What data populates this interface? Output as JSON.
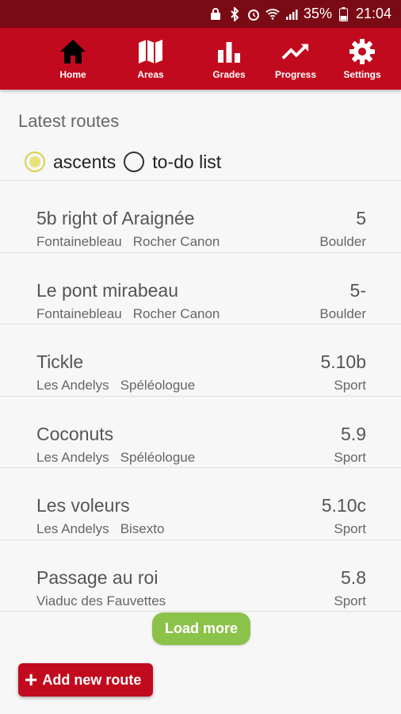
{
  "status_bar": {
    "battery": "35%",
    "time": "21:04",
    "icons": [
      "lock-icon",
      "bluetooth-icon",
      "alarm-icon",
      "wifi-icon",
      "signal-icon",
      "battery-icon"
    ]
  },
  "nav": {
    "items": [
      {
        "label": "Home",
        "icon": "home-icon"
      },
      {
        "label": "Areas",
        "icon": "map-icon"
      },
      {
        "label": "Grades",
        "icon": "bar-chart-icon"
      },
      {
        "label": "Progress",
        "icon": "trending-up-icon"
      },
      {
        "label": "Settings",
        "icon": "gear-icon"
      }
    ],
    "active": "Home"
  },
  "heading": "Latest routes",
  "filter": {
    "options": [
      "ascents",
      "to-do list"
    ],
    "selected": "ascents"
  },
  "routes": [
    {
      "name": "5b right of Araignée",
      "grade": "5",
      "area": "Fontainebleau",
      "sector": "Rocher Canon",
      "type": "Boulder"
    },
    {
      "name": "Le pont mirabeau",
      "grade": "5-",
      "area": "Fontainebleau",
      "sector": "Rocher Canon",
      "type": "Boulder"
    },
    {
      "name": "Tickle",
      "grade": "5.10b",
      "area": "Les Andelys",
      "sector": "Spéléologue",
      "type": "Sport"
    },
    {
      "name": "Coconuts",
      "grade": "5.9",
      "area": "Les Andelys",
      "sector": "Spéléologue",
      "type": "Sport"
    },
    {
      "name": "Les voleurs",
      "grade": "5.10c",
      "area": "Les Andelys",
      "sector": "Bisexto",
      "type": "Sport"
    },
    {
      "name": "Passage au roi",
      "grade": "5.8",
      "area": "Viaduc des Fauvettes",
      "sector": "",
      "type": "Sport"
    }
  ],
  "load_more_label": "Load more",
  "add_route_label": "Add new route",
  "colors": {
    "brand_red": "#c20a1e",
    "status_bar": "#7a0a14",
    "load_more_green": "#8bc34a",
    "radio_selected": "#e8e27a"
  }
}
